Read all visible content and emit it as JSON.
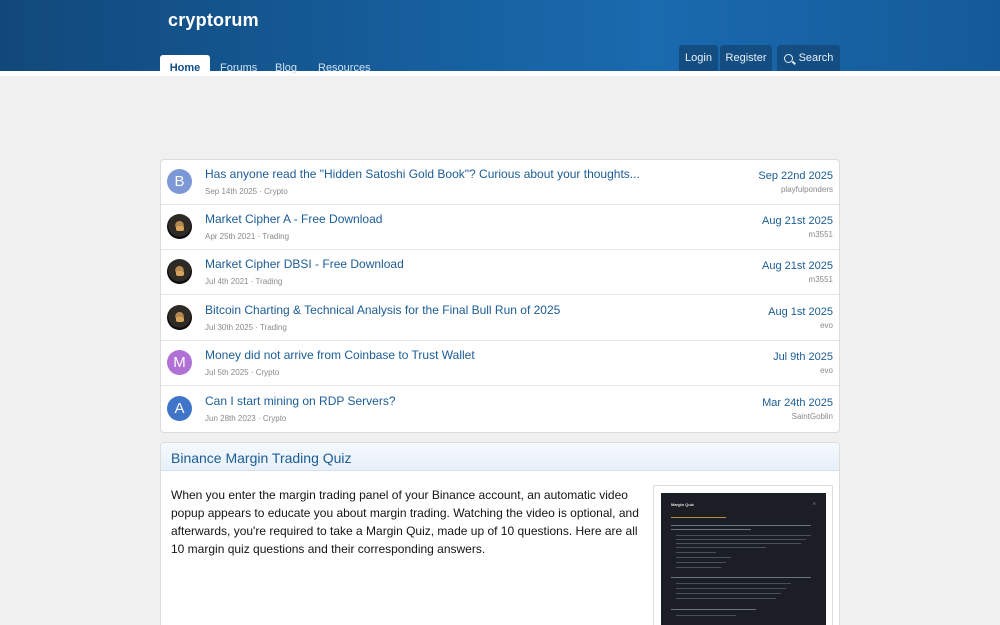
{
  "site": {
    "name": "cryptorum"
  },
  "nav": {
    "tabs": [
      "Home",
      "Forums",
      "Blog",
      "Resources"
    ]
  },
  "header_actions": {
    "login": "Login",
    "register": "Register",
    "search": "Search"
  },
  "threads": [
    {
      "avatar": "B",
      "avatar_color": "#7c98d6",
      "title": "Has anyone read the \"Hidden Satoshi Gold Book\"? Curious about your thoughts...",
      "meta": "Sep 14th 2025 · Crypto",
      "date": "Sep 22nd 2025",
      "user": "playfulponders"
    },
    {
      "avatar": "",
      "avatar_color": "",
      "title": "Market Cipher A - Free Download",
      "meta": "Apr 25th 2021 · Trading",
      "date": "Aug 21st 2025",
      "user": "m3551"
    },
    {
      "avatar": "",
      "avatar_color": "",
      "title": "Market Cipher DBSI - Free Download",
      "meta": "Jul 4th 2021 · Trading",
      "date": "Aug 21st 2025",
      "user": "m3551"
    },
    {
      "avatar": "",
      "avatar_color": "",
      "title": "Bitcoin Charting & Technical Analysis for the Final Bull Run of 2025",
      "meta": "Jul 30th 2025 · Trading",
      "date": "Aug 1st 2025",
      "user": "evo"
    },
    {
      "avatar": "M",
      "avatar_color": "#b070d6",
      "title": "Money did not arrive from Coinbase to Trust Wallet",
      "meta": "Jul 5th 2025 · Crypto",
      "date": "Jul 9th 2025",
      "user": "evo"
    },
    {
      "avatar": "A",
      "avatar_color": "#3f74c9",
      "title": "Can I start mining on RDP Servers?",
      "meta": "Jun 28th 2023 · Crypto",
      "date": "Mar 24th 2025",
      "user": "SaintGoblin"
    }
  ],
  "article": {
    "title": "Binance Margin Trading Quiz",
    "body": "When you enter the margin trading panel of your Binance account, an automatic video popup appears to educate you about margin trading. Watching the video is optional, and afterwards, you're required to take a Margin Quiz, made up of 10 questions. Here are all 10 margin quiz questions and their corresponding answers.",
    "thumbnail_title": "Margin Quiz"
  }
}
